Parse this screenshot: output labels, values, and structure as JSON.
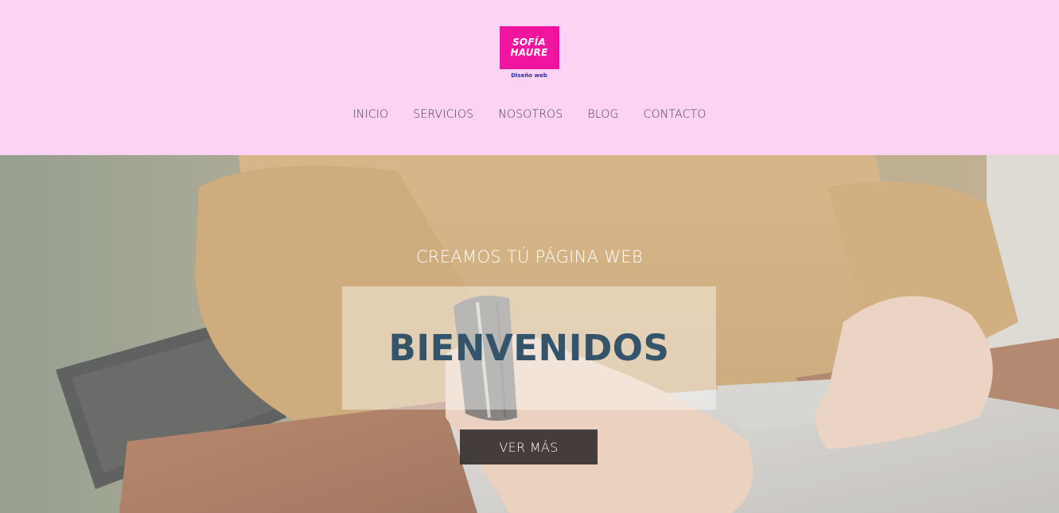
{
  "brand": {
    "name_line1": "SOFÍA",
    "name_line2": "HAURE",
    "tagline": "Diseño web",
    "color": "#f0149f"
  },
  "nav": {
    "items": [
      {
        "label": "INICIO"
      },
      {
        "label": "SERVICIOS"
      },
      {
        "label": "NOSOTROS"
      },
      {
        "label": "BLOG"
      },
      {
        "label": "CONTACTO"
      }
    ]
  },
  "hero": {
    "subtitle": "CREAMOS TÚ PÁGINA WEB",
    "title": "BIENVENIDOS",
    "button_label": "VER MÁS",
    "image": "person-typing-on-laptop-photo"
  },
  "colors": {
    "header_bg": "#fdd3f3",
    "title_color": "#33546b",
    "button_bg": "#2c2826"
  }
}
